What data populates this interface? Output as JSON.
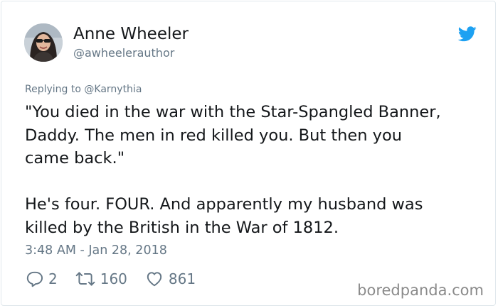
{
  "author": {
    "name": "Anne Wheeler",
    "handle": "@awheelerauthor"
  },
  "reply_context": {
    "prefix": "Replying to ",
    "to": "@Karnythia"
  },
  "tweet": {
    "paragraph1": "\"You died in the war with the Star-Spangled Banner,\nDaddy. The men in red killed you. But then you\ncame back.\"",
    "paragraph2": "He's four. FOUR. And apparently my husband was\nkilled by the British in the War of 1812."
  },
  "timestamp": "3:48 AM - Jan 28, 2018",
  "actions": {
    "replies": "2",
    "retweets": "160",
    "likes": "861"
  },
  "watermark": "boredpanda.com",
  "colors": {
    "twitter_blue": "#1da1f2",
    "secondary_text": "#657786",
    "primary_text": "#14171a"
  },
  "icons": {
    "brand": "twitter-bird-icon",
    "reply": "reply-icon",
    "retweet": "retweet-icon",
    "like": "heart-icon"
  }
}
